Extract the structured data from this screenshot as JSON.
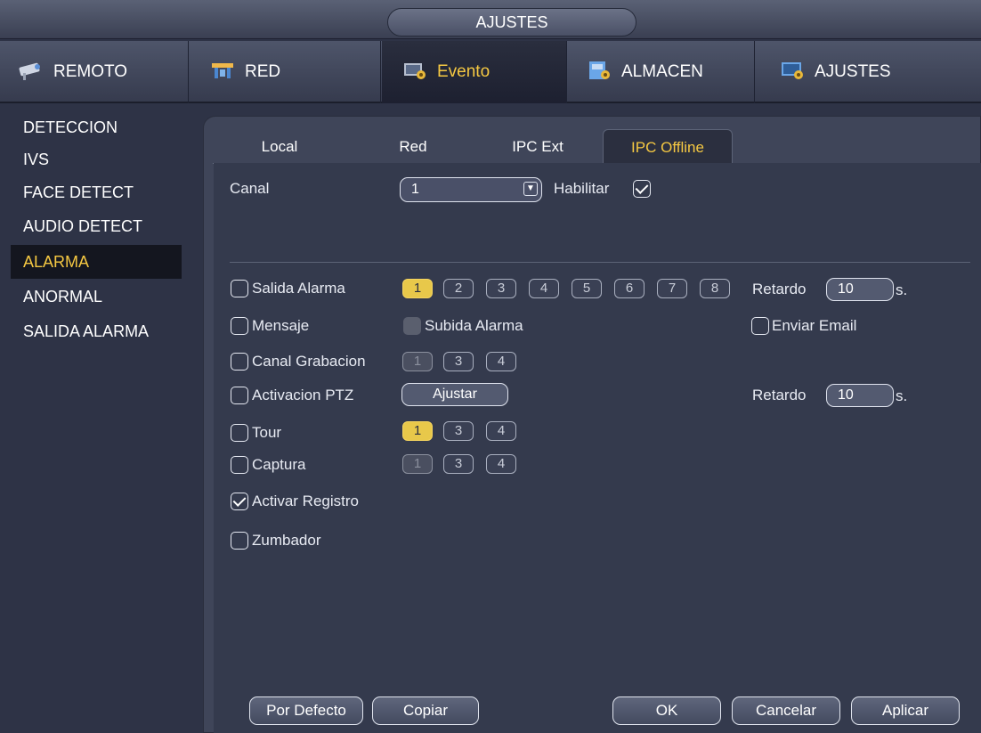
{
  "window": {
    "title": "AJUSTES"
  },
  "main_tabs": [
    {
      "label": "REMOTO",
      "icon": "camera-icon"
    },
    {
      "label": "RED",
      "icon": "network-icon"
    },
    {
      "label": "Evento",
      "icon": "event-icon",
      "active": true
    },
    {
      "label": "ALMACEN",
      "icon": "storage-icon"
    },
    {
      "label": "AJUSTES",
      "icon": "settings-icon"
    }
  ],
  "sidebar": {
    "items": [
      {
        "label": "DETECCION"
      },
      {
        "label": "IVS"
      },
      {
        "label": "FACE DETECT"
      },
      {
        "label": "AUDIO DETECT"
      },
      {
        "label": "ALARMA",
        "active": true
      },
      {
        "label": "ANORMAL"
      },
      {
        "label": "SALIDA ALARMA"
      }
    ]
  },
  "sub_tabs": [
    {
      "label": "Local"
    },
    {
      "label": "Red"
    },
    {
      "label": "IPC Ext"
    },
    {
      "label": "IPC Offline",
      "active": true
    }
  ],
  "form": {
    "canal_label": "Canal",
    "canal_value": "1",
    "habilitar_label": "Habilitar",
    "habilitar_checked": true,
    "salida_alarma_label": "Salida Alarma",
    "salida_alarma_numbers": [
      "1",
      "2",
      "3",
      "4",
      "5",
      "6",
      "7",
      "8"
    ],
    "retardo_label": "Retardo",
    "retardo_value": "10",
    "retardo_unit": "s.",
    "mensaje_label": "Mensaje",
    "subida_alarma_label": "Subida Alarma",
    "enviar_email_label": "Enviar Email",
    "canal_grabacion_label": "Canal Grabacion",
    "canal_grabacion_numbers": [
      "1",
      "3",
      "4"
    ],
    "activacion_ptz_label": "Activacion PTZ",
    "ajustar_label": "Ajustar",
    "retardo2_label": "Retardo",
    "retardo2_value": "10",
    "retardo2_unit": "s.",
    "tour_label": "Tour",
    "tour_numbers": [
      "1",
      "3",
      "4"
    ],
    "captura_label": "Captura",
    "captura_numbers": [
      "1",
      "3",
      "4"
    ],
    "activar_registro_label": "Activar Registro",
    "activar_registro_checked": true,
    "zumbador_label": "Zumbador"
  },
  "buttons": {
    "por_defecto": "Por Defecto",
    "copiar": "Copiar",
    "ok": "OK",
    "cancelar": "Cancelar",
    "aplicar": "Aplicar"
  },
  "colors": {
    "accent": "#f5c842",
    "background": "#2e3346",
    "panel": "#343a4d"
  }
}
